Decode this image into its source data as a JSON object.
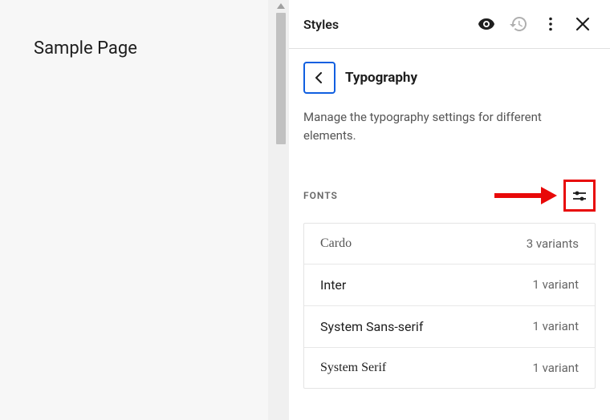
{
  "preview": {
    "title": "Sample Page"
  },
  "panel": {
    "header_title": "Styles",
    "section_title": "Typography",
    "description": "Manage the typography settings for different elements.",
    "fonts_label": "FONTS",
    "fonts": [
      {
        "name": "Cardo",
        "variants": "3 variants",
        "style": "cardo"
      },
      {
        "name": "Inter",
        "variants": "1 variant",
        "style": ""
      },
      {
        "name": "System Sans-serif",
        "variants": "1 variant",
        "style": ""
      },
      {
        "name": "System Serif",
        "variants": "1 variant",
        "style": "serif"
      }
    ]
  }
}
